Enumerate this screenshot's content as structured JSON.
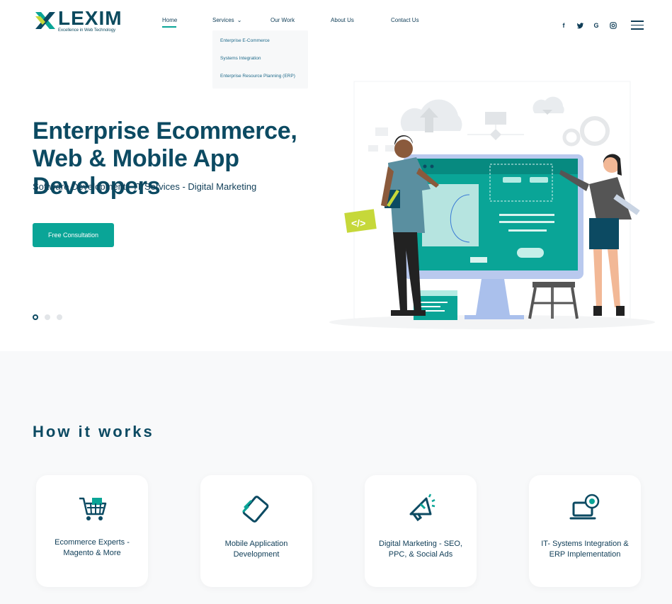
{
  "header": {
    "logo": {
      "name": "LEXIM",
      "tagline": "Excellence in Web Technology"
    },
    "nav": {
      "home": "Home",
      "services": "Services",
      "our_work": "Our Work",
      "about": "About Us",
      "contact": "Contact Us"
    },
    "services_dropdown": [
      "Enterprise E-Commerce",
      "Systems Integration",
      "Enterprise Resource Planning (ERP)"
    ],
    "social": [
      "facebook-icon",
      "twitter-icon",
      "google-icon",
      "instagram-icon"
    ],
    "menu_icon": "hamburger-icon"
  },
  "hero": {
    "title": "Enterprise Ecommerce, Web & Mobile App Developers",
    "subtitle": "Software Development - IT Services - Digital Marketing",
    "cta": "Free Consultation",
    "slides": 3,
    "active_slide": 1
  },
  "how": {
    "title": "How it works",
    "cards": [
      {
        "label": "Ecommerce Experts - Magento & More",
        "icon": "shopping-cart-icon"
      },
      {
        "label": "Mobile Application Development",
        "icon": "mobile-device-icon"
      },
      {
        "label": "Digital Marketing - SEO, PPC, & Social Ads",
        "icon": "megaphone-icon"
      },
      {
        "label": "IT- Systems Integration & ERP Implementation",
        "icon": "laptop-gear-icon"
      }
    ]
  },
  "colors": {
    "accent": "#0aa597",
    "navy": "#0c4a62",
    "lime": "#c6d83a"
  }
}
